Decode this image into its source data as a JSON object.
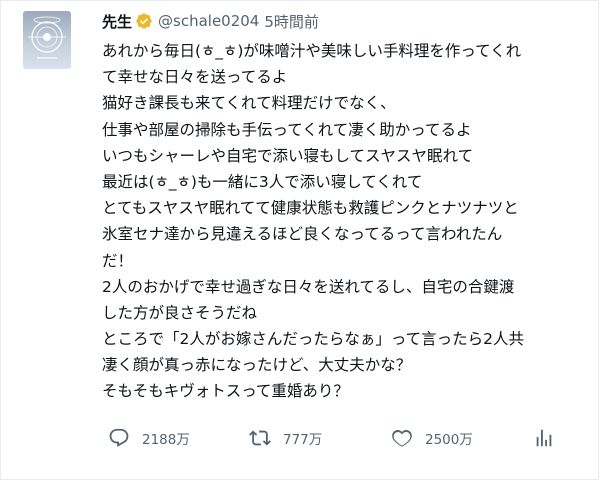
{
  "tweet": {
    "display_name": "先生",
    "handle": "@schale0204",
    "time": "5時間前",
    "lines": [
      "あれから毎日(ㅎ_ㅎ)が味噌汁や美味しい手料理を作ってくれ",
      "て幸せな日々を送ってるよ",
      "猫好き課長も来てくれて料理だけでなく、",
      "仕事や部屋の掃除も手伝ってくれて凄く助かってるよ",
      "いつもシャーレや自宅で添い寝もしてスヤスヤ眠れて",
      "最近は(ㅎ_ㅎ)も一緒に3人で添い寝してくれて",
      "とてもスヤスヤ眠れてて健康状態も救護ピンクとナツナツと",
      "氷室セナ達から見違えるほど良くなってるって言われたん",
      "だ！",
      "2人のおかげで幸せ過ぎな日々を送れてるし、自宅の合鍵渡",
      "した方が良さそうだね",
      "ところで「2人がお嫁さんだったらなぁ」って言ったら2人共",
      "凄く顔が真っ赤になったけど、大丈夫かな？",
      "そもそもキヴォトスって重婚あり？"
    ],
    "actions": {
      "reply_count": "2188万",
      "retweet_count": "777万",
      "like_count": "2500万"
    }
  },
  "colors": {
    "text": "#0f1419",
    "muted": "#536471",
    "verified_badge": "#e8b92f"
  }
}
